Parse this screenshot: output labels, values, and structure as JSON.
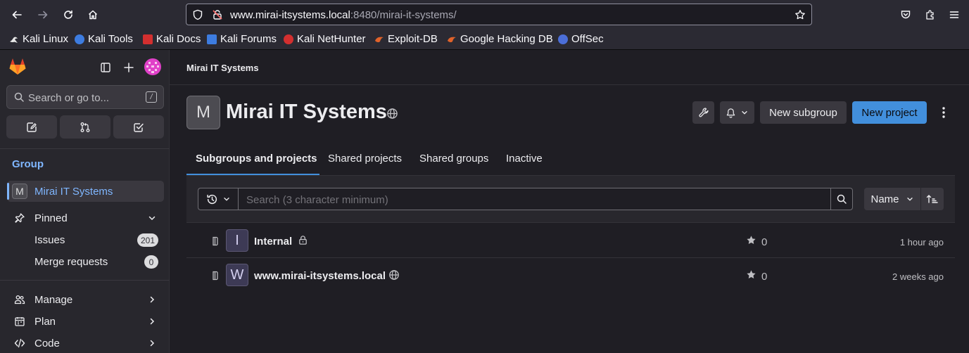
{
  "browser": {
    "url_host": "www.mirai-itsystems.local",
    "url_rest": ":8480/mirai-it-systems/",
    "bookmarks": [
      {
        "label": "Kali Linux",
        "icon": "kali-dragon-icon",
        "color": "#e8e8e8"
      },
      {
        "label": "Kali Tools",
        "icon": "kali-tools-icon",
        "color": "#3d7ce0"
      },
      {
        "label": "Kali Docs",
        "icon": "kali-docs-icon",
        "color": "#d32f2f"
      },
      {
        "label": "Kali Forums",
        "icon": "kali-forums-icon",
        "color": "#3d7ce0"
      },
      {
        "label": "Kali NetHunter",
        "icon": "nethunter-icon",
        "color": "#d32f2f"
      },
      {
        "label": "Exploit-DB",
        "icon": "exploit-db-icon",
        "color": "#e0622a"
      },
      {
        "label": "Google Hacking DB",
        "icon": "ghdb-icon",
        "color": "#e0622a"
      },
      {
        "label": "OffSec",
        "icon": "offsec-icon",
        "color": "#4b6ed8"
      }
    ]
  },
  "sidebar": {
    "search_placeholder": "Search or go to...",
    "search_shortcut": "/",
    "context_heading": "Group",
    "current_group": {
      "avatar": "M",
      "name": "Mirai IT Systems"
    },
    "pinned_label": "Pinned",
    "pinned_items": [
      {
        "label": "Issues",
        "count": "201"
      },
      {
        "label": "Merge requests",
        "count": "0"
      }
    ],
    "sections": [
      {
        "label": "Manage",
        "icon": "users-icon"
      },
      {
        "label": "Plan",
        "icon": "plan-icon"
      },
      {
        "label": "Code",
        "icon": "code-icon"
      }
    ]
  },
  "header": {
    "breadcrumb": "Mirai IT Systems"
  },
  "group": {
    "avatar": "M",
    "title": "Mirai IT Systems",
    "new_subgroup_label": "New subgroup",
    "new_project_label": "New project"
  },
  "tabs": [
    {
      "label": "Subgroups and projects",
      "active": true
    },
    {
      "label": "Shared projects",
      "active": false
    },
    {
      "label": "Shared groups",
      "active": false
    },
    {
      "label": "Inactive",
      "active": false
    }
  ],
  "filter": {
    "placeholder": "Search (3 character minimum)",
    "sort_label": "Name"
  },
  "projects": [
    {
      "avatar": "I",
      "name": "Internal",
      "visibility": "private",
      "stars": "0",
      "updated": "1 hour ago"
    },
    {
      "avatar": "W",
      "name": "www.mirai-itsystems.local",
      "visibility": "public",
      "stars": "0",
      "updated": "2 weeks ago"
    }
  ],
  "colors": {
    "accent": "#428fdc",
    "link_blue": "#7fb6ff",
    "background": "#1f1e24",
    "sidebar": "#28272d"
  }
}
